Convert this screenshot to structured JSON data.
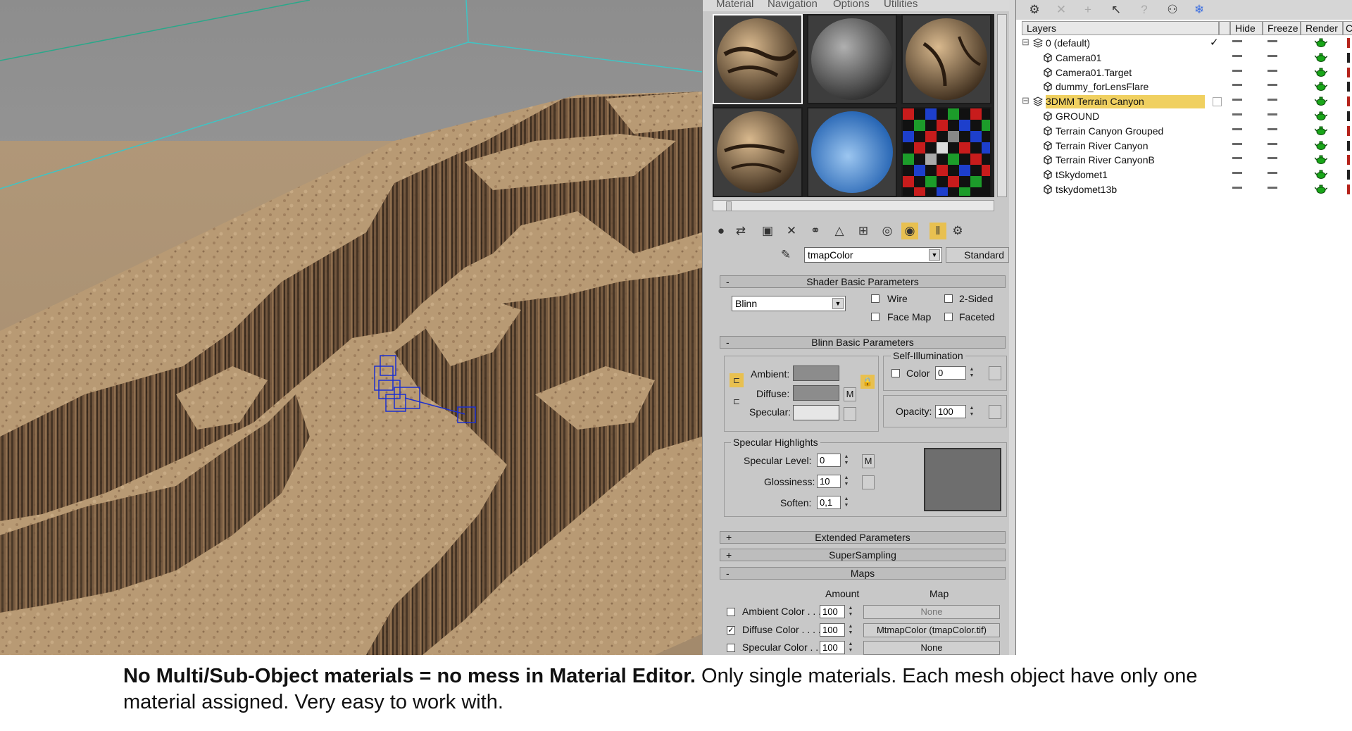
{
  "material_editor": {
    "menu": [
      "Material",
      "Navigation",
      "Options",
      "Utilities"
    ],
    "material_name": "tmapColor",
    "material_type": "Standard",
    "rollouts": {
      "shader_basic": "Shader Basic Parameters",
      "blinn_basic": "Blinn Basic Parameters",
      "extended": "Extended Parameters",
      "supersampling": "SuperSampling",
      "maps": "Maps"
    },
    "shader": {
      "type": "Blinn",
      "wire": "Wire",
      "two_sided": "2-Sided",
      "face_map": "Face Map",
      "faceted": "Faceted"
    },
    "blinn": {
      "ambient": "Ambient:",
      "diffuse": "Diffuse:",
      "specular": "Specular:",
      "m_label": "M",
      "self_illum_title": "Self-Illumination",
      "color_label": "Color",
      "color_value": "0",
      "opacity_label": "Opacity:",
      "opacity_value": "100",
      "ambient_color": "#8c8c8c",
      "diffuse_color": "#8c8c8c",
      "specular_color": "#e6e6e6"
    },
    "specular_highlights": {
      "title": "Specular Highlights",
      "level_label": "Specular Level:",
      "level_value": "0",
      "gloss_label": "Glossiness:",
      "gloss_value": "10",
      "soften_label": "Soften:",
      "soften_value": "0,1",
      "m_label": "M"
    },
    "maps": {
      "amount_header": "Amount",
      "map_header": "Map",
      "rows": [
        {
          "label": "Ambient Color . . .",
          "amount": "100",
          "map": "None",
          "checked": false
        },
        {
          "label": "Diffuse Color . . . .",
          "amount": "100",
          "map": "MtmapColor (tmapColor.tif)",
          "checked": true
        },
        {
          "label": "Specular Color . .",
          "amount": "100",
          "map": "None",
          "checked": false
        }
      ]
    }
  },
  "layers": {
    "headers": {
      "layers": "Layers",
      "hide": "Hide",
      "freeze": "Freeze",
      "render": "Render",
      "color": "Co"
    },
    "rows": [
      {
        "name": "0 (default)",
        "type": "layer",
        "check": "✓"
      },
      {
        "name": "Camera01",
        "type": "object"
      },
      {
        "name": "Camera01.Target",
        "type": "object"
      },
      {
        "name": "dummy_forLensFlare",
        "type": "object"
      },
      {
        "name": "3DMM Terrain Canyon",
        "type": "layer",
        "selected": true
      },
      {
        "name": "GROUND",
        "type": "object"
      },
      {
        "name": "Terrain Canyon Grouped",
        "type": "object"
      },
      {
        "name": "Terrain River Canyon",
        "type": "object"
      },
      {
        "name": "Terrain River CanyonB",
        "type": "object"
      },
      {
        "name": "tSkydomet1",
        "type": "object"
      },
      {
        "name": "tskydomet13b",
        "type": "object"
      }
    ],
    "expand_symbol": "⊟"
  },
  "caption": {
    "bold": "No Multi/Sub-Object materials = no mess in Material Editor.",
    "rest": " Only single materials. Each mesh object have only one material assigned. Very easy to work with."
  }
}
